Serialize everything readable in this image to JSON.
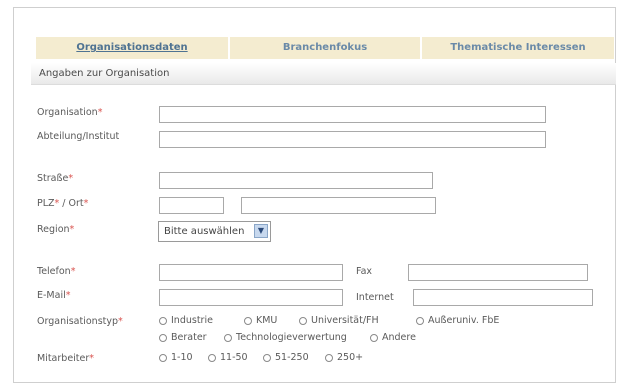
{
  "tabs": [
    {
      "label": "Organisationsdaten"
    },
    {
      "label": "Branchenfokus"
    },
    {
      "label": "Thematische Interessen"
    }
  ],
  "section": {
    "title": "Angaben zur Organisation"
  },
  "fields": {
    "organisation": "Organisation",
    "abteilung": "Abteilung/Institut",
    "strasse": "Straße",
    "plz": "PLZ",
    "ort": " / Ort",
    "region": "Region",
    "telefon": "Telefon",
    "fax": "Fax",
    "email": "E-Mail",
    "internet": "Internet",
    "organisationstyp": "Organisationstyp",
    "mitarbeiter": "Mitarbeiter"
  },
  "required_marker": "*",
  "region_select": {
    "value": "Bitte auswählen"
  },
  "organisationstyp_options": [
    "Industrie",
    "KMU",
    "Universität/FH",
    "Außeruniv. FbE",
    "Berater",
    "Technologieverwertung",
    "Andere"
  ],
  "mitarbeiter_options": [
    "1-10",
    "11-50",
    "51-250",
    "250+"
  ]
}
